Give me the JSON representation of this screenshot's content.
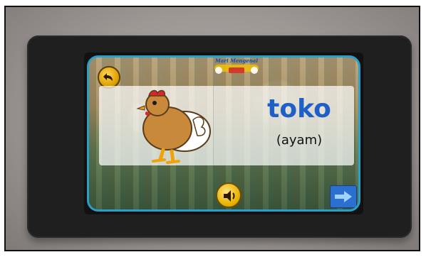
{
  "app": {
    "logo_text": "Mari Mengenal",
    "word": "toko",
    "translation": "(ayam)"
  },
  "icons": {
    "back": "back-arrow-icon",
    "sound": "speaker-icon",
    "next": "right-arrow-icon",
    "picture": "chicken-icon"
  },
  "colors": {
    "word": "#1e5fc8",
    "frame_border": "#2aa0c9",
    "button_gold": "#e0a400",
    "next_blue": "#2b6fd0"
  }
}
